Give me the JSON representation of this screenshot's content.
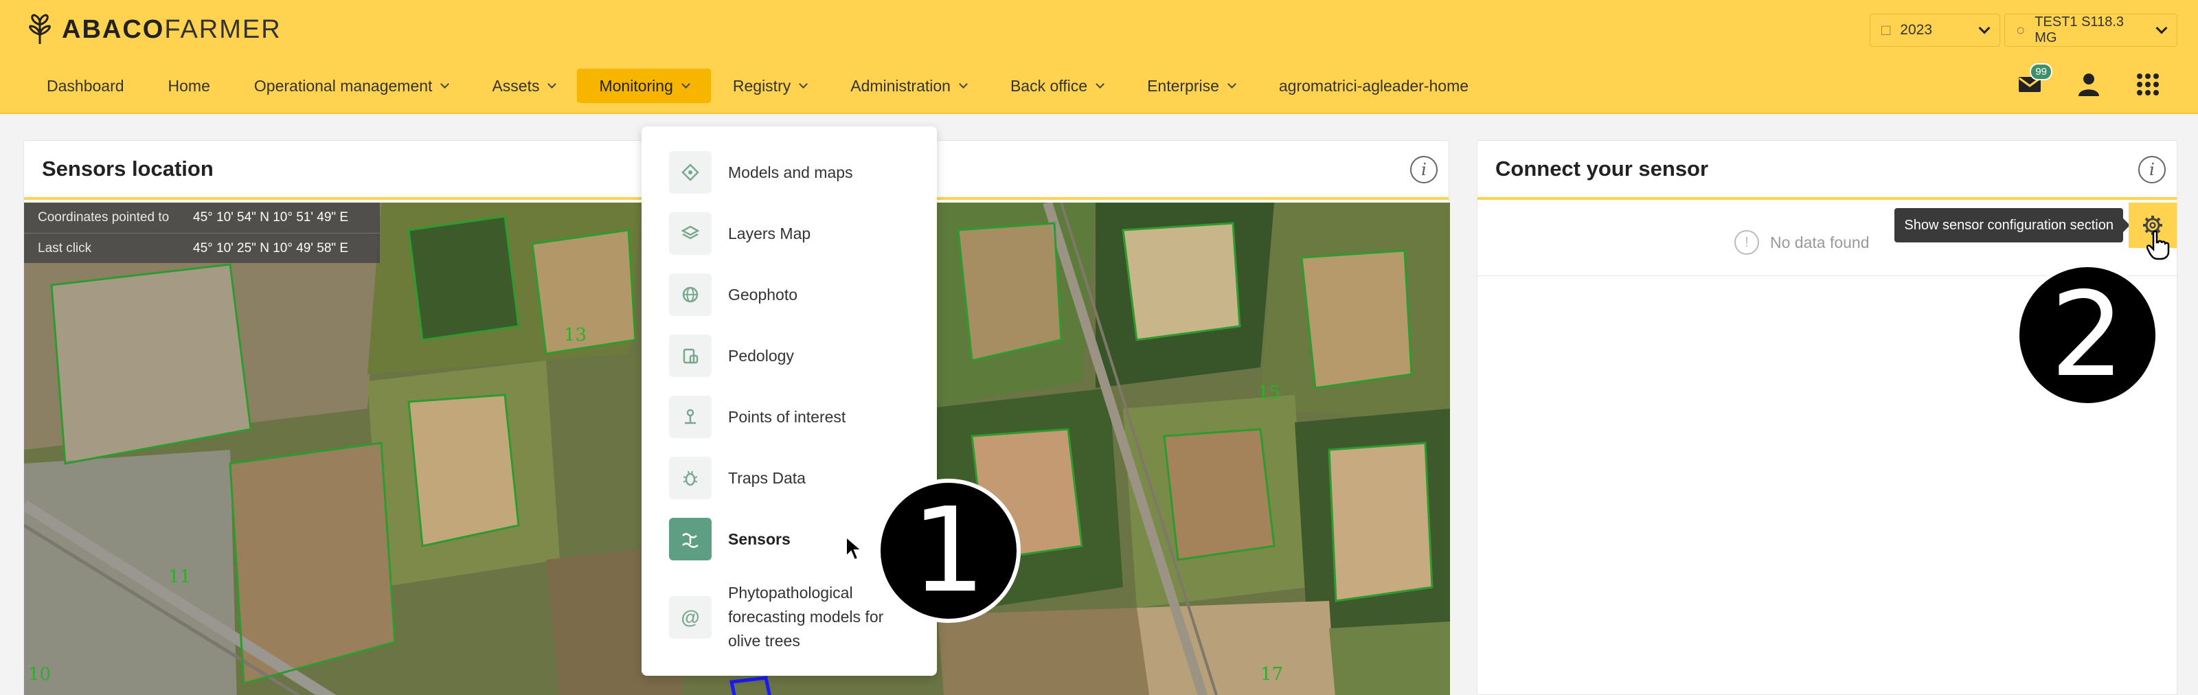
{
  "app": {
    "logo_bold": "ABACO",
    "logo_light": "FARMER"
  },
  "header": {
    "year": "2023",
    "user": "TEST1 S118.3 MG"
  },
  "nav": {
    "items": [
      {
        "label": "Dashboard",
        "dropdown": false
      },
      {
        "label": "Home",
        "dropdown": false
      },
      {
        "label": "Operational management",
        "dropdown": true
      },
      {
        "label": "Assets",
        "dropdown": true
      },
      {
        "label": "Monitoring",
        "dropdown": true,
        "active": true
      },
      {
        "label": "Registry",
        "dropdown": true
      },
      {
        "label": "Administration",
        "dropdown": true
      },
      {
        "label": "Back office",
        "dropdown": true
      },
      {
        "label": "Enterprise",
        "dropdown": true
      },
      {
        "label": "agromatrici-agleader-home",
        "dropdown": false
      }
    ],
    "notification_count": "99"
  },
  "sensors_panel": {
    "title": "Sensors location",
    "coords_label": "Coordinates pointed to",
    "coords_value": "45° 10' 54\" N 10° 51' 49\" E",
    "last_click_label": "Last click",
    "last_click_value": "45° 10' 25\" N 10° 49' 58\" E",
    "map_labels": [
      "13",
      "11",
      "10",
      "15",
      "17"
    ]
  },
  "monitoring_menu": {
    "items": [
      {
        "label": "Models and maps",
        "icon": "models-icon"
      },
      {
        "label": "Layers Map",
        "icon": "layers-icon"
      },
      {
        "label": "Geophoto",
        "icon": "globe-icon"
      },
      {
        "label": "Pedology",
        "icon": "pedology-icon"
      },
      {
        "label": "Points of interest",
        "icon": "pin-icon"
      },
      {
        "label": "Traps Data",
        "icon": "bug-icon"
      },
      {
        "label": "Sensors",
        "icon": "sensor-icon",
        "active": true
      },
      {
        "label": "Phytopathological forecasting models for olive trees",
        "icon": "at-icon"
      }
    ]
  },
  "connect_panel": {
    "title": "Connect your sensor",
    "empty_text": "No data found",
    "tooltip": "Show sensor configuration section"
  },
  "markers": [
    "1",
    "2"
  ],
  "colors": {
    "accent": "#ffd24f",
    "active_nav": "#f7b500",
    "sensor_green": "#5e9e82"
  }
}
